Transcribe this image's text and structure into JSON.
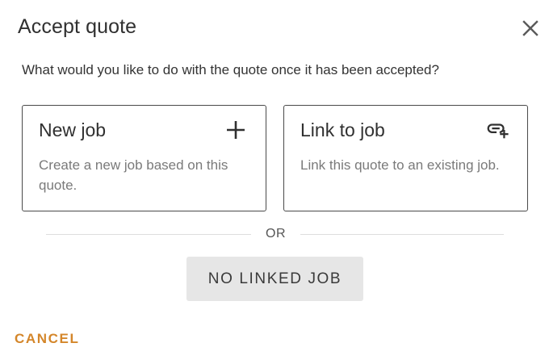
{
  "dialog": {
    "title": "Accept quote",
    "close_icon": "close-icon",
    "question": "What would you like to do with the quote once it has been accepted?"
  },
  "options": {
    "new_job": {
      "title": "New job",
      "description": "Create a new job based on this quote.",
      "icon": "plus-icon"
    },
    "link_job": {
      "title": "Link to job",
      "description": "Link this quote to an existing job.",
      "icon": "link-add-icon"
    }
  },
  "divider": {
    "label": "OR"
  },
  "no_linked_job_label": "NO LINKED JOB",
  "cancel_label": "CANCEL",
  "colors": {
    "accent": "#d4862a",
    "secondary_button_bg": "#e6e6e6",
    "card_border": "#4a4a4a"
  }
}
